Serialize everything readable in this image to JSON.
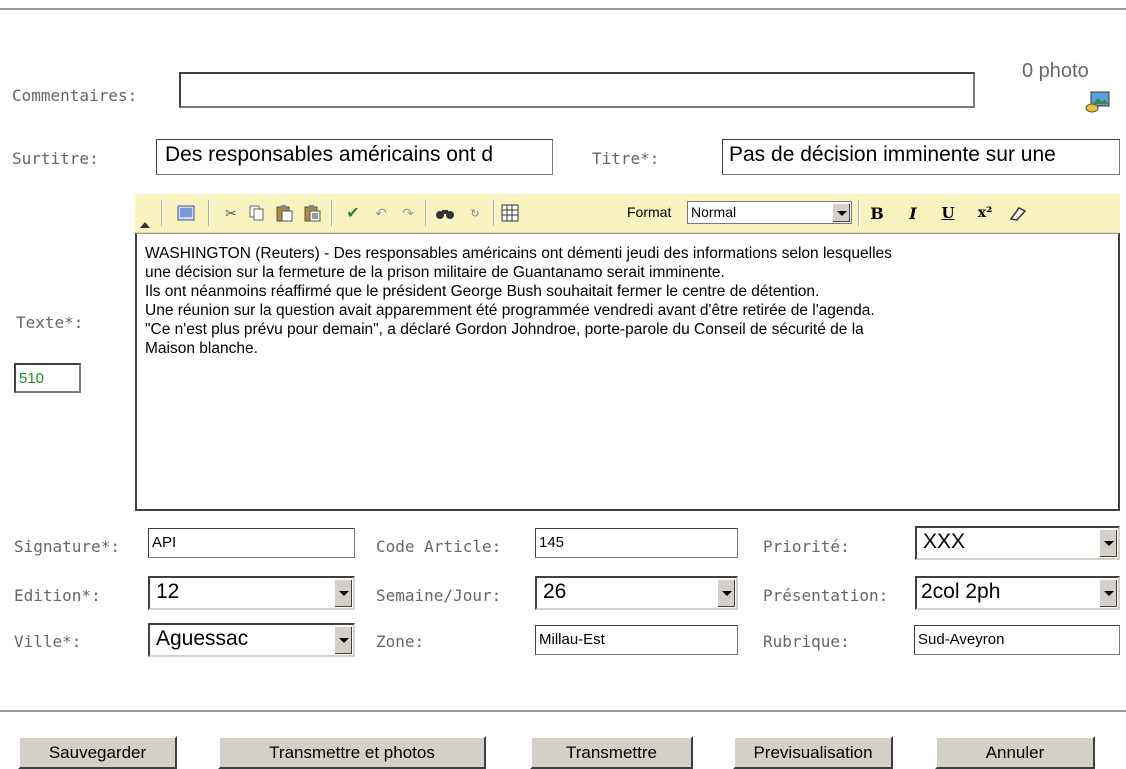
{
  "photo": {
    "count_label": "0 photo"
  },
  "form": {
    "commentaires": {
      "label": "Commentaires:",
      "value": ""
    },
    "surtitre": {
      "label": "Surtitre:",
      "value": "Des responsables américains ont d"
    },
    "titre": {
      "label": "Titre*:",
      "value": "Pas de décision imminente sur une"
    },
    "texte": {
      "label": "Texte*:",
      "count": "510",
      "lines": [
        "WASHINGTON (Reuters) - Des responsables américains ont démenti jeudi des informations selon lesquelles",
        "une décision sur la fermeture de la prison militaire de Guantanamo serait imminente.",
        "Ils ont néanmoins réaffirmé que le président George Bush souhaitait fermer le centre de détention.",
        "Une réunion sur la question avait apparemment été programmée vendredi avant d'être retirée de l'agenda.",
        "\"Ce n'est plus prévu pour demain\", a déclaré Gordon Johndroe, porte-parole du Conseil de sécurité de la",
        "Maison blanche."
      ]
    },
    "signature": {
      "label": "Signature*:",
      "value": "API"
    },
    "code_article": {
      "label": "Code Article:",
      "value": "145"
    },
    "priorite": {
      "label": "Priorité:",
      "value": "XXX"
    },
    "edition": {
      "label": "Edition*:",
      "value": "12"
    },
    "semaine_jour": {
      "label": "Semaine/Jour:",
      "value": "26"
    },
    "presentation": {
      "label": "Présentation:",
      "value": "2col 2ph"
    },
    "ville": {
      "label": "Ville*:",
      "value": "Aguessac"
    },
    "zone": {
      "label": "Zone:",
      "value": "Millau-Est"
    },
    "rubrique": {
      "label": "Rubrique:",
      "value": "Sud-Aveyron"
    }
  },
  "toolbar": {
    "format_label": "Format",
    "format_value": "Normal",
    "bold": "B",
    "italic": "I",
    "underline": "U",
    "superscript": "x²"
  },
  "buttons": {
    "save": "Sauvegarder",
    "transmit_photos": "Transmettre et photos",
    "transmit": "Transmettre",
    "preview": "Previsualisation",
    "cancel": "Annuler"
  }
}
